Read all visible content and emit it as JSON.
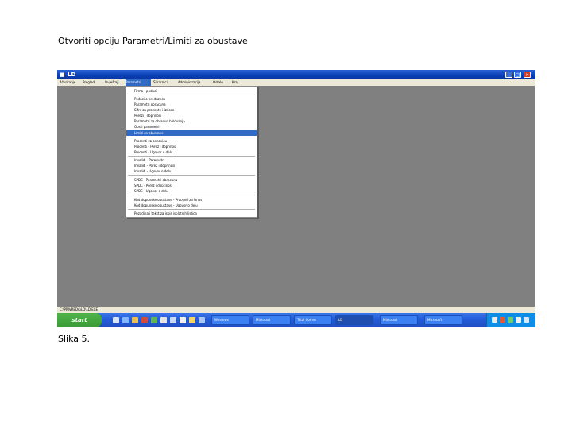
{
  "page": {
    "heading": "Otvoriti opciju Parametri/Limiti za obustave",
    "caption": "Slika 5."
  },
  "window": {
    "title": "LD",
    "buttons": [
      "_",
      "□",
      "×"
    ]
  },
  "menubar": {
    "items": [
      "Ažuriranje",
      "Pregled",
      "Izvještaji",
      "Parametri",
      "Sifrarnici",
      "Administracija",
      "Ostalo",
      "Kraj"
    ],
    "active_index": 3
  },
  "dropdown": {
    "highlighted": "Limiti za obustave",
    "items": [
      "Firma - podaci",
      "Podaci o preduzecu",
      "Parametri obracuna",
      "Sifre za procente i iznose",
      "Porezi i doprinosi",
      "Parametri za obracun bolovanja",
      "Opsti parametri",
      "Limiti za obustave",
      "Procenti za osnovicu",
      "Procenti - Porez i doprinosi",
      "Procenti - Ugovor o delu",
      "Invalidi - Parametri",
      "Invalidi - Porez i doprinosi",
      "Invalidi - Ugovor o delu",
      "SPDC - Parametri obracuna",
      "SPDC - Porez i doprinosi",
      "SPDC - Ugovor o delu",
      "Kod dopunske obustave - Procenti za iznos",
      "Kod dopunske obustave - Ugovor o delu",
      "Pozadina i tekst za ispis isplatnih listica"
    ]
  },
  "statusbar": {
    "text": "C:\\PRIVREDA\\LD\\LD.EXE"
  },
  "taskbar": {
    "start_label": "start",
    "tasks": [
      "Windows",
      "Microsoft",
      "Total Comm",
      "LD",
      "Microsoft",
      "Microsoft"
    ],
    "active_task": "LD"
  },
  "colors": {
    "titlebar": "#0a3fb5",
    "desktop": "#808080",
    "menu": "#ece9d8",
    "highlight": "#316ac5",
    "taskbar": "#245edb",
    "start": "#3a9a36"
  }
}
